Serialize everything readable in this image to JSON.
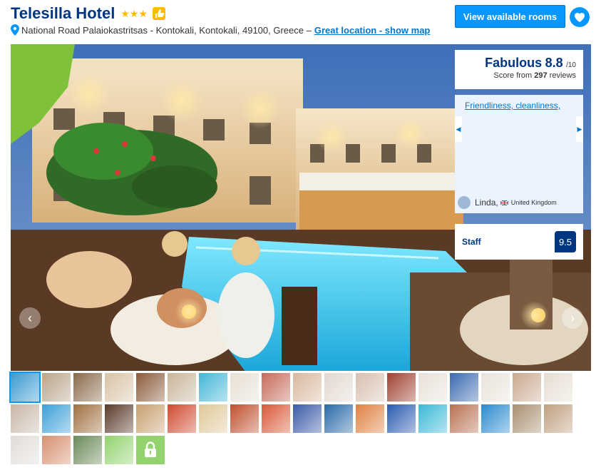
{
  "header": {
    "hotel_name": "Telesilla Hotel",
    "stars": "★★★",
    "address": "National Road Palaiokastritsas - Kontokali, Kontokali, 49100, Greece –",
    "location_link": "Great location - show map",
    "cta_label": "View available rooms"
  },
  "score": {
    "word": "Fabulous",
    "value": "8.8",
    "out_of": "/10",
    "sub_prefix": "Score from",
    "review_count": "297",
    "sub_suffix": "reviews"
  },
  "review": {
    "snippet": "Friendliness, cleanliness,",
    "author": "Linda,",
    "country": "United Kingdom"
  },
  "category": {
    "label": "Staff",
    "value": "9.5"
  },
  "colors": {
    "brand_blue": "#003580",
    "action_blue": "#0896ff",
    "link_blue": "#0077cc",
    "star_yellow": "#febb02",
    "review_bg": "#ebf3ff",
    "lock_green": "#92d36e"
  },
  "icons": {
    "thumb": "thumbs-up-icon",
    "pin": "map-pin-icon",
    "favorite": "heart-icon",
    "prev": "chevron-left-icon",
    "next": "chevron-right-icon",
    "lock": "lock-icon"
  },
  "thumbnails": {
    "count": 41,
    "selected_index": 0,
    "palette": [
      "#3a9ad0",
      "#b9a48a",
      "#8a6a4a",
      "#d8c3a6",
      "#8b5a3a",
      "#c9b59a",
      "#42b7d6",
      "#e7e0d3",
      "#c76a5a",
      "#d8b8a0",
      "#e2d8d0",
      "#d8c0b0",
      "#a04030",
      "#e8e0d8",
      "#3a6ab0",
      "#e9e3da",
      "#caa990",
      "#e5ddd2",
      "#c8b8a8",
      "#3aa0d8",
      "#a07040",
      "#5a3a2a",
      "#c8a070",
      "#d04a30",
      "#e0c898",
      "#c05030",
      "#d85a3a",
      "#3a5aa8",
      "#2a6aa8",
      "#e08040",
      "#2a5ab0",
      "#3ab8d8",
      "#b87050",
      "#2a8ad0",
      "#a89070",
      "#c0a080",
      "#e0dcd8",
      "#d89070",
      "#6a8a5a",
      "#92d36e"
    ]
  }
}
